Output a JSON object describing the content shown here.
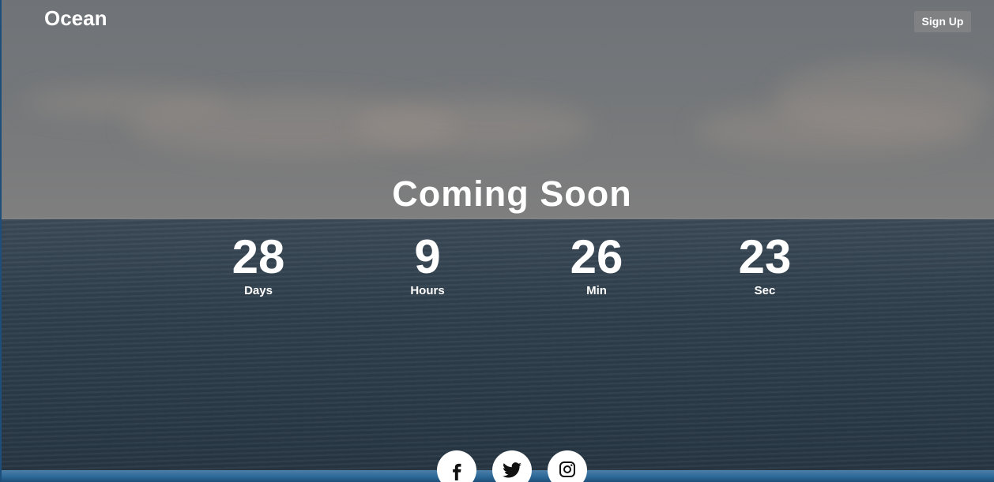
{
  "header": {
    "brand": "Ocean",
    "signup_label": "Sign Up"
  },
  "hero": {
    "heading": "Coming Soon"
  },
  "countdown": [
    {
      "value": "28",
      "label": "Days"
    },
    {
      "value": "9",
      "label": "Hours"
    },
    {
      "value": "26",
      "label": "Min"
    },
    {
      "value": "23",
      "label": "Sec"
    }
  ],
  "social": [
    {
      "icon": "facebook-icon"
    },
    {
      "icon": "twitter-icon"
    },
    {
      "icon": "instagram-icon"
    }
  ],
  "colors": {
    "text": "#ffffff",
    "sky": "#727578",
    "sea": "#2f3f4c",
    "button_bg": "#8c8c8c"
  }
}
